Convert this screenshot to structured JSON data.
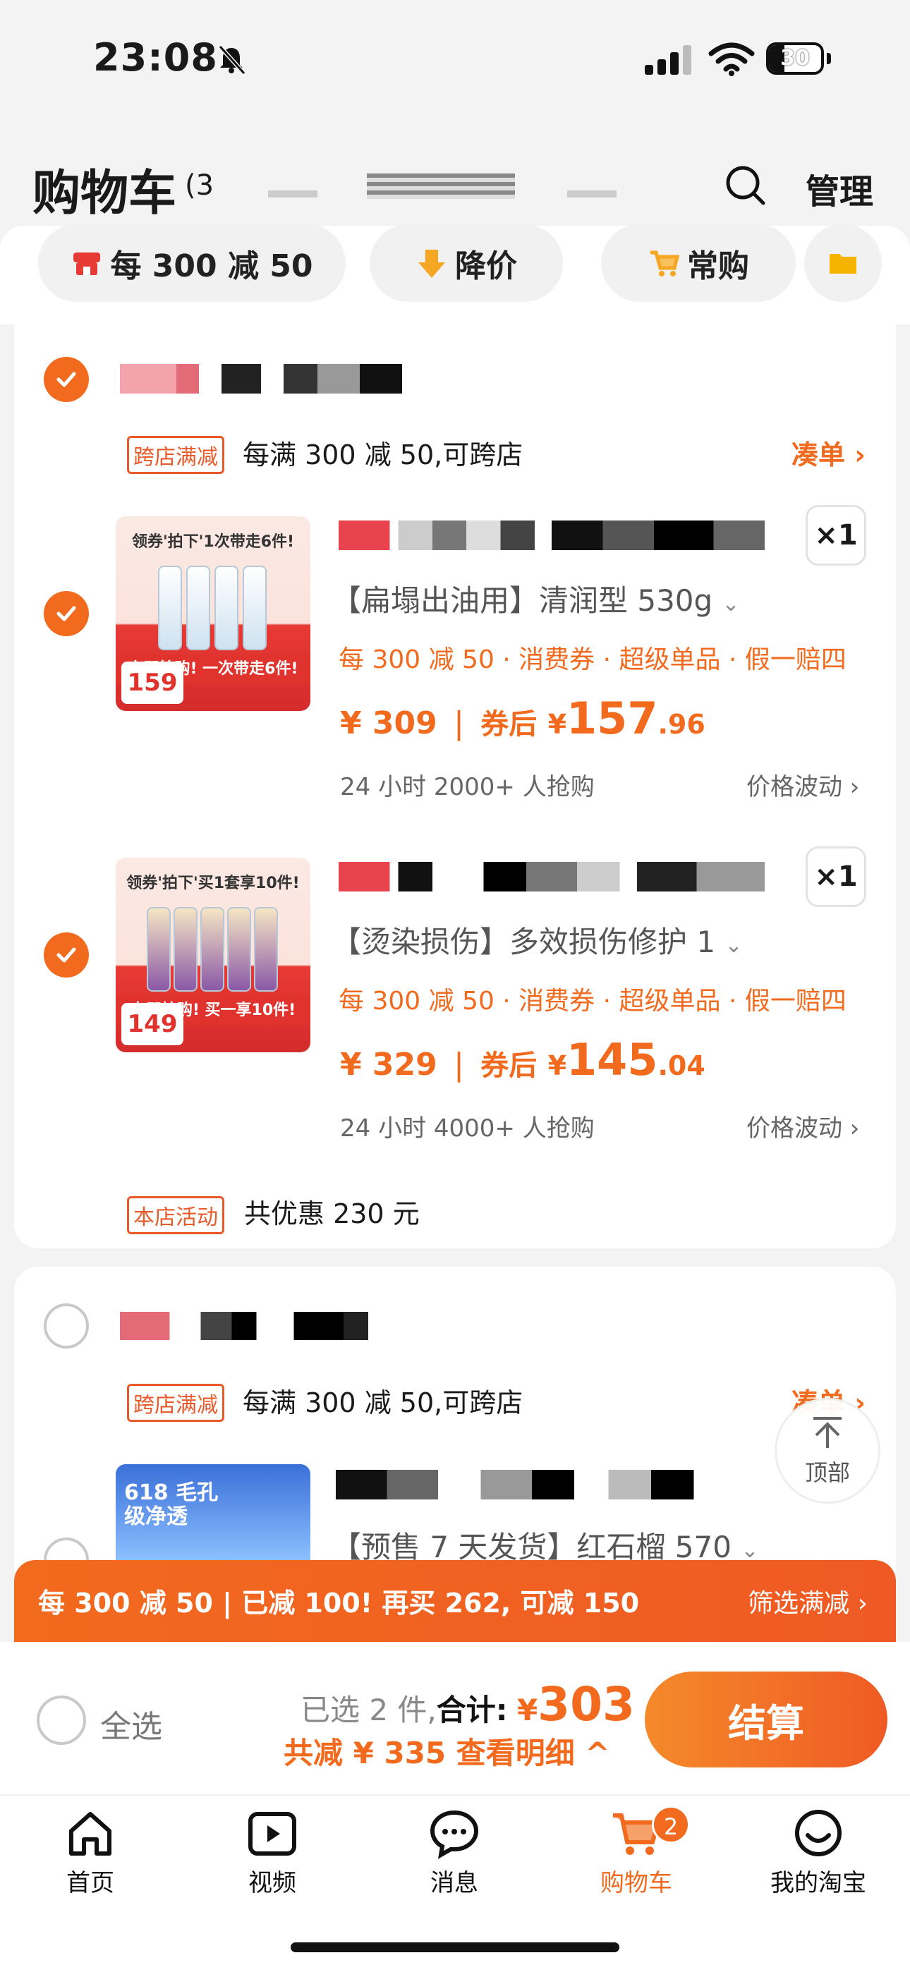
{
  "status_bar": {
    "time": "23:08",
    "battery": "30"
  },
  "header": {
    "title": "购物车",
    "count": "(3",
    "manage": "管理"
  },
  "chips": [
    {
      "label": "每 300 减 50"
    },
    {
      "label": "降价"
    },
    {
      "label": "常购"
    }
  ],
  "store1": {
    "cross_tag": "跨店满减",
    "cross_text": "每满 300 减 50,可跨店",
    "cross_link": "凑单",
    "items": [
      {
        "img_top": "领券'拍下'1次带走6件!",
        "img_band": "立即抢购! 一次带走6件!",
        "img_price": "159",
        "variant": "【扁塌出油用】清润型 530g",
        "qty": "×1",
        "promo": "每 300 减 50 · 消费券 · 超级单品 · 假一赔四",
        "price": "¥ 309",
        "coupon_label": "券后",
        "coupon_currency": "¥",
        "coupon_int": "157",
        "coupon_dec": ".96",
        "sales": "24 小时 2000+ 人抢购",
        "fluct": "价格波动"
      },
      {
        "img_top": "领券'拍下'买1套享10件!",
        "img_band": "立即抢购! 买一享10件!",
        "img_price": "149",
        "variant": "【烫染损伤】多效损伤修护 1",
        "qty": "×1",
        "promo": "每 300 减 50 · 消费券 · 超级单品 · 假一赔四",
        "price": "¥ 329",
        "coupon_label": "券后",
        "coupon_currency": "¥",
        "coupon_int": "145",
        "coupon_dec": ".04",
        "sales": "24 小时 4000+ 人抢购",
        "fluct": "价格波动"
      }
    ],
    "activity_tag": "本店活动",
    "activity_text": "共优惠 230 元"
  },
  "store2": {
    "cross_tag": "跨店满减",
    "cross_text": "每满 300 减 50,可跨店",
    "cross_link": "凑单",
    "item_variant": "【预售 7 天发货】红石榴 570",
    "img_text": "618 毛孔级净透"
  },
  "top_button": "顶部",
  "promo_bar": {
    "left": "每 300 减 50 | 已减 100! 再买 262, 可减 150",
    "right": "筛选满减"
  },
  "checkout": {
    "select_all": "全选",
    "selected": "已选 2 件,",
    "total_label": "合计:",
    "total_currency": "¥",
    "total": "303",
    "discount": "共减 ¥ 335 查看明细 ^",
    "button": "结算"
  },
  "tabs": [
    {
      "label": "首页"
    },
    {
      "label": "视频"
    },
    {
      "label": "消息"
    },
    {
      "label": "购物车",
      "badge": "2"
    },
    {
      "label": "我的淘宝"
    }
  ],
  "colors": {
    "accent": "#f26a1e",
    "background": "#f3f3f3"
  }
}
